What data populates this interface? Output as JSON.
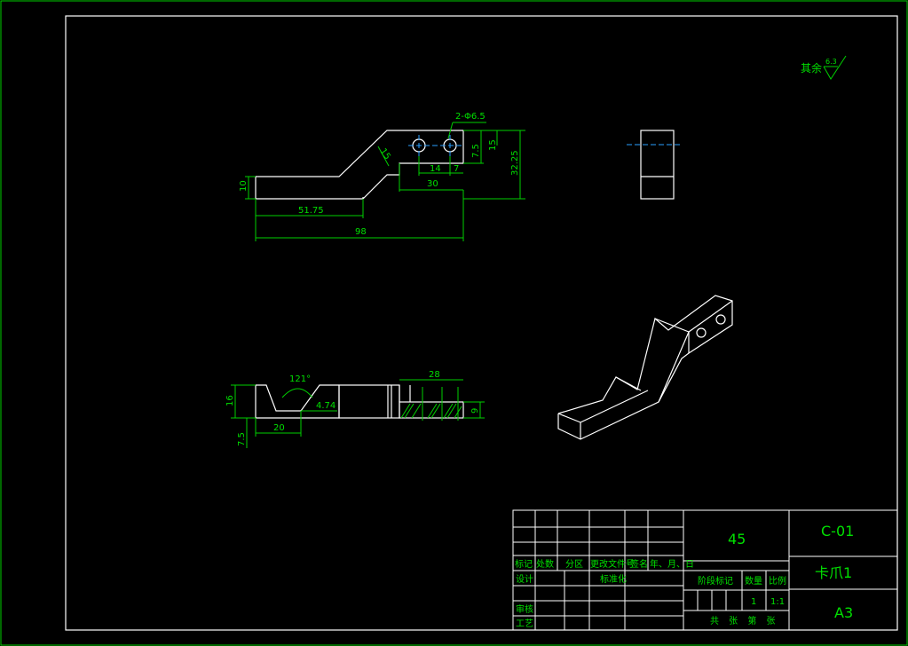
{
  "roughness": {
    "label": "其余",
    "value": "6.3"
  },
  "front_view": {
    "hole_callout": "2-Φ6.5",
    "dims": {
      "d15": "15",
      "d7_5": "7.5",
      "d32_25": "32.25",
      "d14": "14",
      "d7": "7",
      "d30": "30",
      "d10": "10",
      "d51_75": "51.75",
      "d98": "98",
      "d15_slant": "15"
    }
  },
  "bottom_view": {
    "dims": {
      "angle": "121°",
      "d4_74": "4.74",
      "d16": "16",
      "d20": "20",
      "d7_5": "7.5"
    }
  },
  "section_view": {
    "dims": {
      "d28": "28",
      "d9": "9"
    }
  },
  "title_block": {
    "material": "45",
    "drawing_number": "C-01",
    "part_name": "卡爪1",
    "sheet_size": "A3",
    "headers": [
      "标记",
      "处数",
      "分区",
      "更改文件号",
      "签名",
      "年、月、日"
    ],
    "row_labels": {
      "design": "设计",
      "standardize": "标准化",
      "check": "审核",
      "process": "工艺"
    },
    "stage_label": "阶段标记",
    "quantity_label": "数量",
    "scale_label": "比例",
    "quantity_value": "1",
    "scale_value": "1:1",
    "sheets_text": "共 张 第 张"
  }
}
